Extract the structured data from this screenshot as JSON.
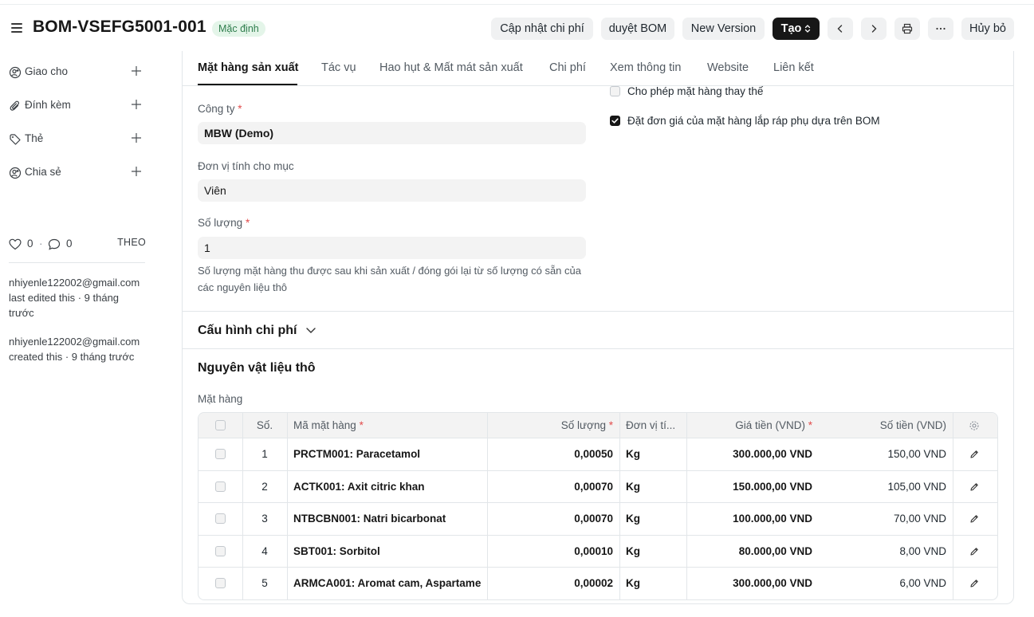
{
  "header": {
    "title": "BOM-VSEFG5001-001",
    "status_badge": "Mặc định",
    "buttons": {
      "update_cost": "Cập nhật chi phí",
      "approve_bom": "duyệt BOM",
      "new_version": "New Version",
      "create": "Tạo",
      "cancel": "Hủy bỏ"
    }
  },
  "sidebar": {
    "items": [
      {
        "label": "Giao cho",
        "icon": "assign-icon"
      },
      {
        "label": "Đính kèm",
        "icon": "paperclip-icon"
      },
      {
        "label": "Thẻ",
        "icon": "tag-icon"
      },
      {
        "label": "Chia sẻ",
        "icon": "share-icon"
      }
    ],
    "likes": "0",
    "comments": "0",
    "follow": "THEO",
    "activity": [
      {
        "user": "nhiyenle122002@gmail.com",
        "text": "last edited this · 9 tháng trước"
      },
      {
        "user": "nhiyenle122002@gmail.com",
        "text": "created this · 9 tháng trước"
      }
    ]
  },
  "tabs": [
    "Mặt hàng sản xuất",
    "Tác vụ",
    "Hao hụt & Mất mát sản xuất",
    "Chi phí",
    "Xem thông tin",
    "Website",
    "Liên kết"
  ],
  "form": {
    "company_label": "Công ty",
    "company_value": "MBW (Demo)",
    "uom_label": "Đơn vị tính cho mục",
    "uom_value": "Viên",
    "qty_label": "Số lượng",
    "qty_value": "1",
    "qty_help": "Số lượng mặt hàng thu được sau khi sản xuất / đóng gói lại từ số lượng có sẵn của các nguyên liệu thô",
    "allow_alt_label": "Cho phép mặt hàng thay thế",
    "allow_alt_checked": false,
    "set_rate_label": "Đặt đơn giá của mặt hàng lắp ráp phụ dựa trên BOM",
    "set_rate_checked": true
  },
  "sections": {
    "cost_config": "Cấu hình chi phí",
    "raw_materials": "Nguyên vật liệu thô",
    "items_label": "Mặt hàng"
  },
  "table": {
    "headers": {
      "no": "Số.",
      "item_code": "Mã mặt hàng",
      "qty": "Số lượng",
      "uom": "Đơn vị tí...",
      "rate": "Giá tiền (VND)",
      "amount": "Số tiền (VND)"
    },
    "rows": [
      {
        "no": "1",
        "item": "PRCTM001: Paracetamol",
        "qty": "0,00050",
        "uom": "Kg",
        "rate": "300.000,00 VND",
        "amount": "150,00 VND"
      },
      {
        "no": "2",
        "item": "ACTK001: Axit citric khan",
        "qty": "0,00070",
        "uom": "Kg",
        "rate": "150.000,00 VND",
        "amount": "105,00 VND"
      },
      {
        "no": "3",
        "item": "NTBCBN001: Natri bicarbonat",
        "qty": "0,00070",
        "uom": "Kg",
        "rate": "100.000,00 VND",
        "amount": "70,00 VND"
      },
      {
        "no": "4",
        "item": "SBT001: Sorbitol",
        "qty": "0,00010",
        "uom": "Kg",
        "rate": "80.000,00 VND",
        "amount": "8,00 VND"
      },
      {
        "no": "5",
        "item": "ARMCA001: Aromat cam, Aspartame",
        "qty": "0,00002",
        "uom": "Kg",
        "rate": "300.000,00 VND",
        "amount": "6,00 VND"
      }
    ]
  }
}
